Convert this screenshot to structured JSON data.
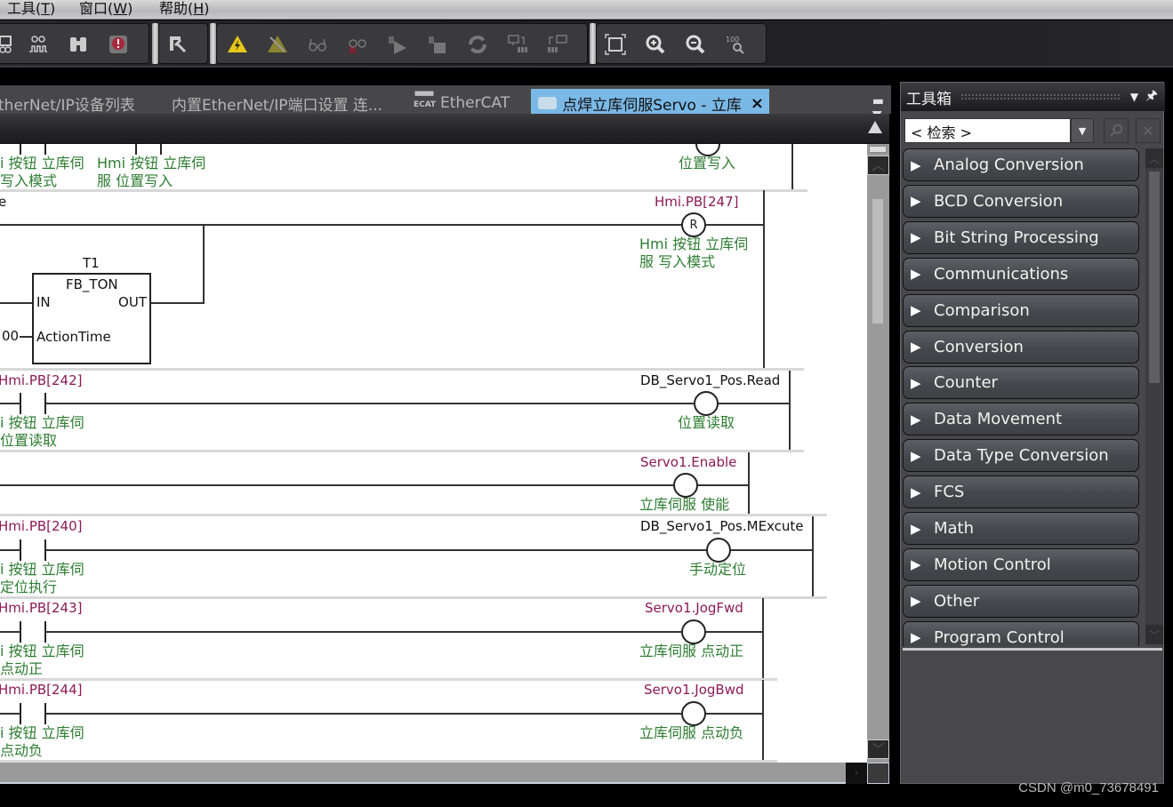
{
  "menu": [
    {
      "label": "工具(",
      "key": "T",
      "suffix": ")"
    },
    {
      "label": "窗口(",
      "key": "W",
      "suffix": ")"
    },
    {
      "label": "帮助(",
      "key": "H",
      "suffix": ")"
    }
  ],
  "toolbar": {
    "icons": [
      "watch-table-icon",
      "waveform-glasses-icon",
      "binoculars-icon",
      "error-note-icon",
      "build-hammer-icon",
      "online-warning-icon",
      "offline-warning-icon",
      "glasses-icon",
      "glasses-delete-icon",
      "run-program-icon",
      "stop-program-icon",
      "synchronize-icon",
      "transfer-to-controller-icon",
      "transfer-from-controller-icon",
      "fit-to-window-icon",
      "zoom-in-icon",
      "zoom-out-icon",
      "zoom-100-icon"
    ]
  },
  "tabs": [
    {
      "label": "therNet/IP设备列表",
      "active": false
    },
    {
      "label": "内置EtherNet/IP端口设置 连...",
      "active": false
    },
    {
      "label": "EtherCAT",
      "active": false,
      "icon": "ecat-icon"
    },
    {
      "label": "点焊立库伺服Servo - 立库",
      "active": true,
      "icon": "program-icon",
      "close": "×"
    }
  ],
  "accent_color": "#7ab8e6",
  "ladder": {
    "rung0": {
      "comment1a": "i 按钮 立库伺",
      "comment1b": "写入模式",
      "comment2a": "Hmi 按钮 立库伺",
      "comment2b": "服 位置写入",
      "coil_comment": "位置写入"
    },
    "rung1": {
      "left_label": "e",
      "coil_var": "Hmi.PB[247]",
      "coil_type": "R",
      "coil_comment_a": "Hmi 按钮 立库伺",
      "coil_comment_b": "服 写入模式",
      "fb_instance": "T1",
      "fb_type": "FB_TON",
      "fb_in": "IN",
      "fb_out": "OUT",
      "fb_param": "ActionTime",
      "fb_param_value": "00"
    },
    "rung2": {
      "contact_var": "Hmi.PB[242]",
      "contact_comment_a": "i 按钮 立库伺",
      "contact_comment_b": "位置读取",
      "coil_var": "DB_Servo1_Pos.Read",
      "coil_comment": "位置读取"
    },
    "rung3": {
      "coil_var": "Servo1.Enable",
      "coil_comment": "立库伺服 使能"
    },
    "rung4": {
      "contact_var": "Hmi.PB[240]",
      "contact_comment_a": "i 按钮 立库伺",
      "contact_comment_b": "定位执行",
      "coil_var": "DB_Servo1_Pos.MExcute",
      "coil_comment": "手动定位"
    },
    "rung5": {
      "contact_var": "Hmi.PB[243]",
      "contact_comment_a": "i 按钮 立库伺",
      "contact_comment_b": "点动正",
      "coil_var": "Servo1.JogFwd",
      "coil_comment": "立库伺服 点动正"
    },
    "rung6": {
      "contact_var": "Hmi.PB[244]",
      "contact_comment_a": "i 按钮 立库伺",
      "contact_comment_b": "点动负",
      "coil_var": "Servo1.JogBwd",
      "coil_comment": "立库伺服 点动负"
    }
  },
  "toolbox": {
    "title": "工具箱",
    "search_value": "< 检索 >",
    "items": [
      "Analog Conversion",
      "BCD Conversion",
      "Bit String Processing",
      "Communications",
      "Comparison",
      "Conversion",
      "Counter",
      "Data Movement",
      "Data Type Conversion",
      "FCS",
      "Math",
      "Motion Control",
      "Other",
      "Program Control"
    ]
  },
  "watermark": "CSDN @m0_73678491"
}
